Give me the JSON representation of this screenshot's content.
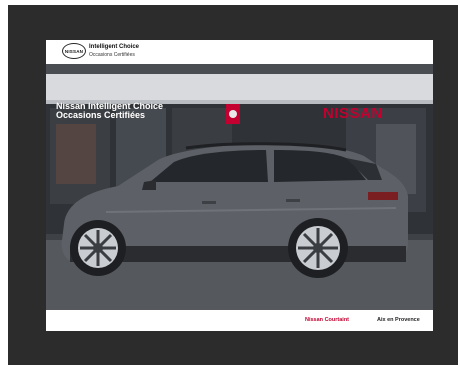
{
  "brand": {
    "logo_text": "NISSAN",
    "title": "Intelligent Choice",
    "subtitle": "Occasions Certifiées"
  },
  "photo": {
    "sign_left_line1": "Nissan Intelligent Choice",
    "sign_left_line2": "Occasions Certifiées",
    "sign_right": "NISSAN"
  },
  "footer": {
    "dealer_name": "Nissan Courtaint",
    "city": "Aix en Provence"
  },
  "colors": {
    "frame": "#2c2c2c",
    "brand_red": "#c3002f",
    "car_body": "#5d6066"
  }
}
